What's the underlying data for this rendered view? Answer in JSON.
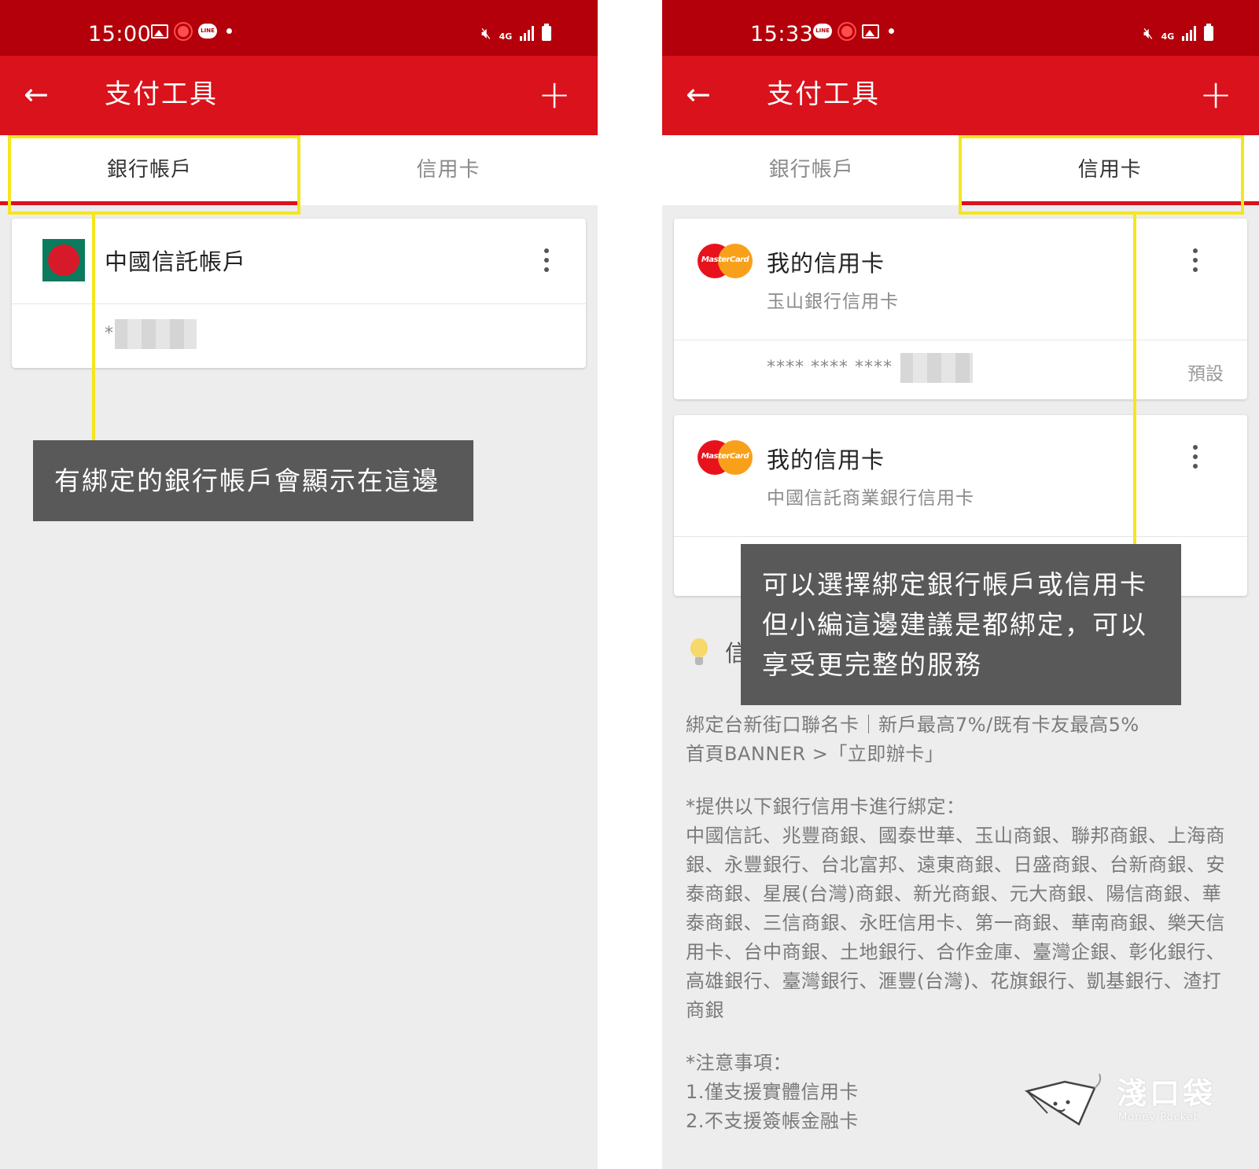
{
  "left": {
    "status": {
      "time": "15:00",
      "network": "4G"
    },
    "appbar": {
      "back_icon": "←",
      "title": "支付工具",
      "add_icon": "+"
    },
    "tabs": [
      {
        "label": "銀行帳戶",
        "active": true
      },
      {
        "label": "信用卡",
        "active": false
      }
    ],
    "account": {
      "name": "中國信託帳戶",
      "number_prefix": "*"
    },
    "annotation": "有綁定的銀行帳戶會顯示在這邊"
  },
  "right": {
    "status": {
      "time": "15:33",
      "network": "4G"
    },
    "appbar": {
      "back_icon": "←",
      "title": "支付工具",
      "add_icon": "+"
    },
    "tabs": [
      {
        "label": "銀行帳戶",
        "active": false
      },
      {
        "label": "信用卡",
        "active": true
      }
    ],
    "cards": [
      {
        "name": "我的信用卡",
        "issuer": "玉山銀行信用卡",
        "number_prefix": "**** **** ****",
        "default_label": "預設",
        "logo_text": "MasterCard"
      },
      {
        "name": "我的信用卡",
        "issuer": "中國信託商業銀行信用卡",
        "logo_text": "MasterCard"
      }
    ],
    "info_heading_partial": "信",
    "info": {
      "promo_line1": "綁定台新街口聯名卡｜新戶最高7%/既有卡友最高5%",
      "promo_line2": "首頁BANNER >「立即辦卡」",
      "supported_title": "*提供以下銀行信用卡進行綁定：",
      "supported_banks": "中國信託、兆豐商銀、國泰世華、玉山商銀、聯邦商銀、上海商銀、永豐銀行、台北富邦、遠東商銀、日盛商銀、台新商銀、安泰商銀、星展(台灣)商銀、新光商銀、元大商銀、陽信商銀、華泰商銀、三信商銀、永旺信用卡、第一商銀、華南商銀、樂天信用卡、台中商銀、土地銀行、合作金庫、臺灣企銀、彰化銀行、高雄銀行、臺灣銀行、滙豐(台灣)、花旗銀行、凱基銀行、渣打商銀",
      "notes_title": "*注意事項：",
      "note1": "1.僅支援實體信用卡",
      "note2": "2.不支援簽帳金融卡"
    },
    "annotation": [
      "可以選擇綁定銀行帳戶或信用卡",
      "但小編這邊建議是都綁定，可以",
      "享受更完整的服務"
    ],
    "watermark": {
      "title": "淺口袋",
      "subtitle": "Money Pocket"
    }
  },
  "colors": {
    "statusbar": "#b3000a",
    "appbar": "#d9121b",
    "highlight": "#f4e61e",
    "tooltip": "#595959",
    "background": "#ededed"
  }
}
